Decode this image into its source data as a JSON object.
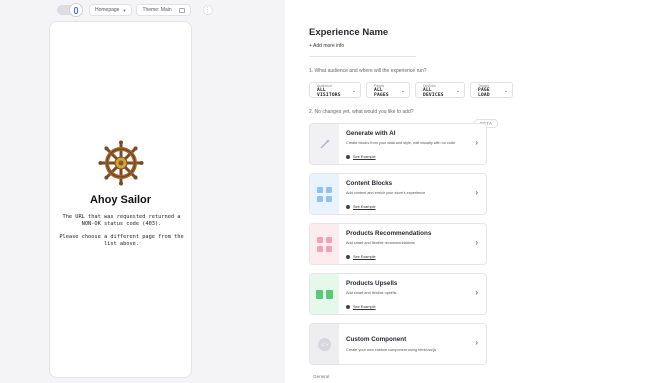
{
  "toolbar": {
    "page_select": "Homepage",
    "theme_label": "Theme: Main"
  },
  "preview": {
    "title": "Ahoy Sailor",
    "message": "The URL that was requested returned a NON-OK status code (403).",
    "message2": "Please choose a different page from the list above."
  },
  "editor": {
    "experience_name": "Experience Name",
    "add_info": "+ Add more info",
    "question1": "1. What audience and where will the experience run?",
    "question2": "2. No changes yet, what would you like to add?",
    "beta_badge": "BETA",
    "general_label": "General",
    "selectors": [
      {
        "label": "Audience",
        "value": "ALL VISITORS"
      },
      {
        "label": "Pages",
        "value": "ALL PAGES"
      },
      {
        "label": "Devices",
        "value": "ALL DEVICES"
      },
      {
        "label": "Trigger",
        "value": "PAGE LOAD"
      }
    ],
    "cards": [
      {
        "title": "Generate with AI",
        "desc": "Create blocks from your data and style, edit visually with no code",
        "example": "See Example"
      },
      {
        "title": "Content Blocks",
        "desc": "Add content and enrich your store's experience",
        "example": "See Example"
      },
      {
        "title": "Products Recommendations",
        "desc": "Add smart and flexible recommendations",
        "example": "See Example"
      },
      {
        "title": "Products Upsells",
        "desc": "Add smart and flexible upsells",
        "example": "See Example"
      },
      {
        "title": "Custom Component",
        "desc": "Create your own custom component using html/css/js",
        "example": ""
      }
    ]
  },
  "colors": {
    "ai_thumb": "#f1f1f4",
    "blocks_thumb": "#e8f3fd",
    "blocks_tile": "#8fc1f2",
    "recs_thumb": "#fdecef",
    "recs_tile": "#f2a3b3",
    "upsell_thumb": "#e6f8ea",
    "upsell_tile": "#59c97a",
    "custom_thumb": "#eeeef1"
  }
}
